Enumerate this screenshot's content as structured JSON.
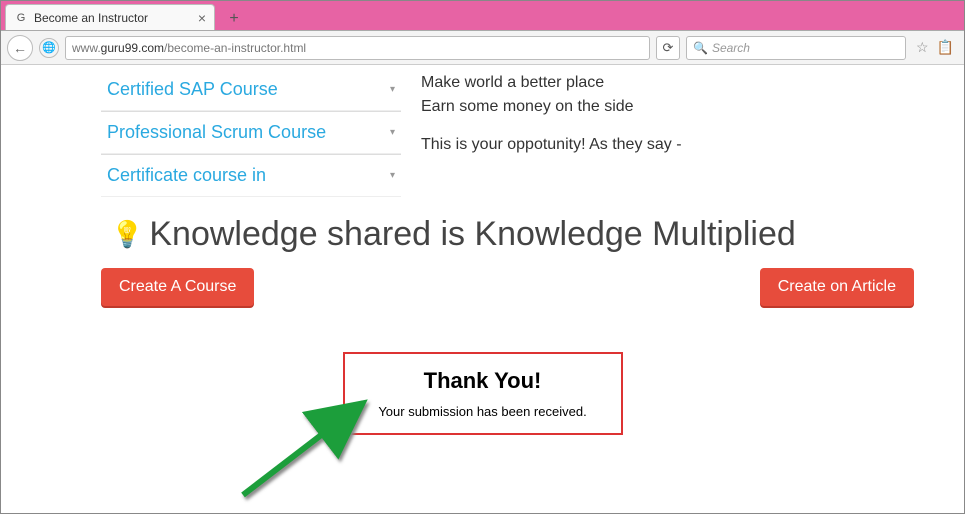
{
  "browser": {
    "tab_title": "Become an Instructor",
    "close_glyph": "×",
    "new_tab_glyph": "+",
    "back_glyph": "←",
    "globe_glyph": "🌐",
    "reload_glyph": "⟳",
    "star_glyph": "☆",
    "clipboard_glyph": "📋",
    "url_pre": "www.",
    "url_host": "guru99.com",
    "url_path": "/become-an-instructor.html",
    "search_placeholder": "Search",
    "search_icon": "🔍"
  },
  "sidebar": {
    "items": [
      {
        "label": "Certified SAP Course"
      },
      {
        "label": "Professional Scrum Course"
      },
      {
        "label": "Certificate course in"
      }
    ],
    "caret": "▾"
  },
  "intro": {
    "line1": "Make world a better place",
    "line2": "Earn some money on the side",
    "line3": "This is your oppotunity! As they say -"
  },
  "headline": {
    "bulb": "💡",
    "text": "Knowledge shared is Knowledge Multiplied"
  },
  "buttons": {
    "create_course": "Create A Course",
    "create_article": "Create on Article"
  },
  "thank": {
    "title": "Thank You!",
    "msg": "Your submission has been received."
  }
}
